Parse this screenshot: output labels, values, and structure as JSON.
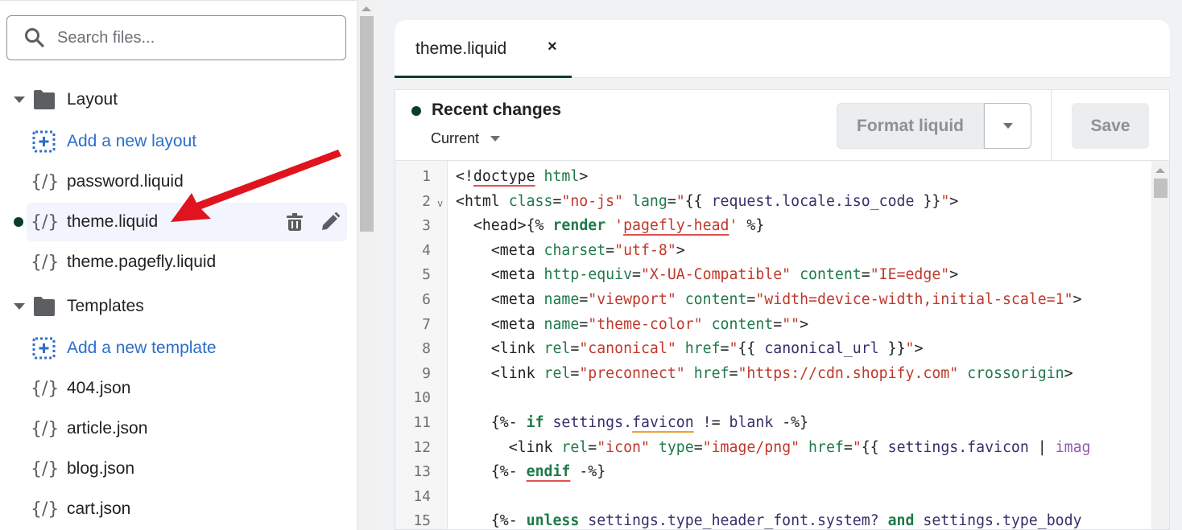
{
  "sidebar": {
    "search": {
      "placeholder": "Search files..."
    },
    "folders": [
      {
        "name": "Layout",
        "add_label": "Add a new layout",
        "files": [
          {
            "name": "password.liquid",
            "selected": false,
            "modified": false
          },
          {
            "name": "theme.liquid",
            "selected": true,
            "modified": true
          },
          {
            "name": "theme.pagefly.liquid",
            "selected": false,
            "modified": false
          }
        ]
      },
      {
        "name": "Templates",
        "add_label": "Add a new template",
        "files": [
          {
            "name": "404.json"
          },
          {
            "name": "article.json"
          },
          {
            "name": "blog.json"
          },
          {
            "name": "cart.json"
          }
        ]
      }
    ],
    "file_icon_glyph": "{/}"
  },
  "tabs": [
    {
      "label": "theme.liquid",
      "close": "×",
      "active": true
    }
  ],
  "toolbar": {
    "status_title": "Recent changes",
    "version_select": "Current",
    "format_label": "Format liquid",
    "save_label": "Save"
  },
  "editor": {
    "line_numbers": [
      "1",
      "2",
      "3",
      "4",
      "5",
      "6",
      "7",
      "8",
      "9",
      "10",
      "11",
      "12",
      "13",
      "14",
      "15"
    ],
    "fold_marker": "v",
    "lines": [
      "<!doctype html>",
      "<html class=\"no-js\" lang=\"{{ request.locale.iso_code }}\">",
      "  <head>{% render 'pagefly-head' %}",
      "    <meta charset=\"utf-8\">",
      "    <meta http-equiv=\"X-UA-Compatible\" content=\"IE=edge\">",
      "    <meta name=\"viewport\" content=\"width=device-width,initial-scale=1\">",
      "    <meta name=\"theme-color\" content=\"\">",
      "    <link rel=\"canonical\" href=\"{{ canonical_url }}\">",
      "    <link rel=\"preconnect\" href=\"https://cdn.shopify.com\" crossorigin>",
      "",
      "    {%- if settings.favicon != blank -%}",
      "      <link rel=\"icon\" type=\"image/png\" href=\"{{ settings.favicon | imag",
      "    {%- endif -%}",
      "",
      "    {%- unless settings.type_header_font.system? and settings.type_body"
    ]
  },
  "colors": {
    "accent": "#0b3d2e",
    "link": "#2c6ecb",
    "annotation_arrow": "#e0141e"
  }
}
